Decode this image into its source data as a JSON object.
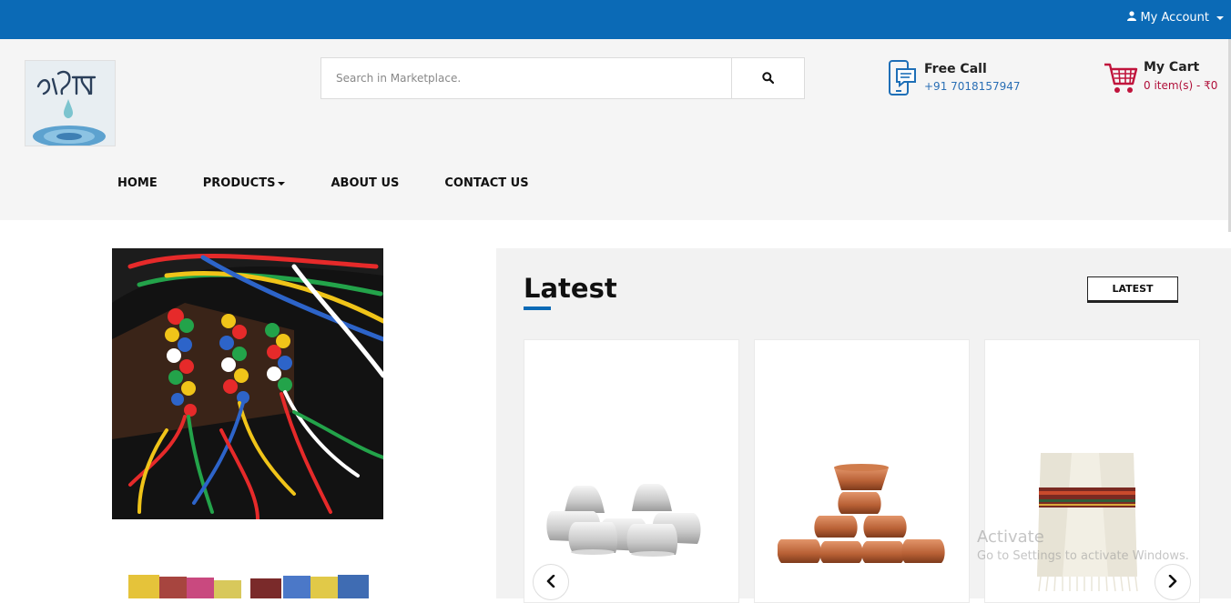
{
  "topbar": {
    "account_label": "My Account",
    "icons": {
      "user": "user-icon",
      "caret": "caret-down-icon"
    },
    "color": "#0b6ab6"
  },
  "search": {
    "placeholder": "Search in Marketplace.",
    "value": "",
    "icon": "search-icon"
  },
  "contact": {
    "title": "Free Call",
    "phone": "+91 7018157947",
    "icon": "phone-chat-icon"
  },
  "cart": {
    "title": "My Cart",
    "summary": "0 item(s) - ₹0",
    "icon": "cart-icon"
  },
  "nav": {
    "items": [
      {
        "label": "HOME"
      },
      {
        "label": "PRODUCTS",
        "has_dropdown": true
      },
      {
        "label": "ABOUT US"
      },
      {
        "label": "CONTACT US"
      }
    ]
  },
  "latest": {
    "heading": "Latest",
    "tab_label": "LATEST",
    "products": [
      {
        "name": "silver-offering-bowls-image"
      },
      {
        "name": "copper-offering-bowls-image"
      },
      {
        "name": "woolen-shawl-image"
      }
    ],
    "prev_icon": "chevron-left-icon",
    "next_icon": "chevron-right-icon"
  },
  "watermark": {
    "line1": "Activate",
    "line2": "Go to Settings to activate Windows."
  }
}
